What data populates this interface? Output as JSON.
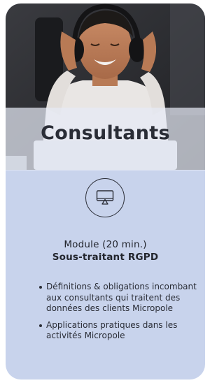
{
  "card": {
    "title": "Consultants",
    "icon": "monitor-icon",
    "module_label": "Module (20 min.)",
    "module_subtitle": "Sous-traitant RGPD",
    "bullets": [
      "Définitions & obligations incombant aux consultants qui traitent des données des clients Micropole",
      "Applications pratiques dans les activités Micropole"
    ]
  },
  "colors": {
    "card_background": "#c8d3ec",
    "text": "#2a2d36"
  }
}
